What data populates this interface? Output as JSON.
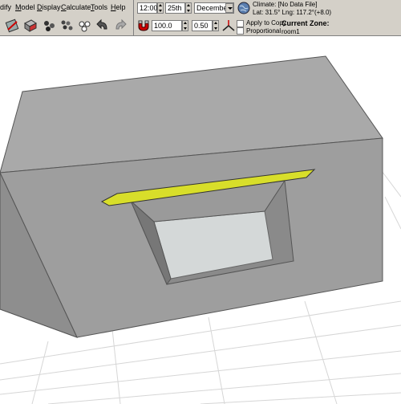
{
  "menu": {
    "items": [
      {
        "label": "dify",
        "underline": "d"
      },
      {
        "label": "Model",
        "underline": "M"
      },
      {
        "label": "Display",
        "underline": "D"
      },
      {
        "label": "Calculate",
        "underline": "C"
      },
      {
        "label": "Tools",
        "underline": "T"
      },
      {
        "label": "Help",
        "underline": "H"
      }
    ]
  },
  "toolbar": {
    "icons": [
      "edit-icon",
      "cube-select-icon",
      "transform-icon",
      "group-icon",
      "lights-icon",
      "undo-icon",
      "redo-icon"
    ]
  },
  "date_time": {
    "time": "12:00",
    "day": "25th",
    "month": "December"
  },
  "climate": {
    "label": "Climate: [No Data File]",
    "location": "Lat: 31.5°   Lng: 117.2°(+8.0)"
  },
  "scale": {
    "value": "100.0",
    "step": "0.50"
  },
  "options": {
    "apply_to_copy": "Apply to Copy",
    "proportional": "Proportional"
  },
  "zone": {
    "heading": "Current Zone:",
    "name": "room1"
  },
  "colors": {
    "toolbar_bg": "#d4d0c8",
    "box_front": "#9e9e9e",
    "box_top": "#a9a9a9",
    "box_side": "#8e8e8e",
    "shading_device": "#d8de2a",
    "window_glass": "#d4d8d8",
    "grid": "#d6d6d6"
  }
}
